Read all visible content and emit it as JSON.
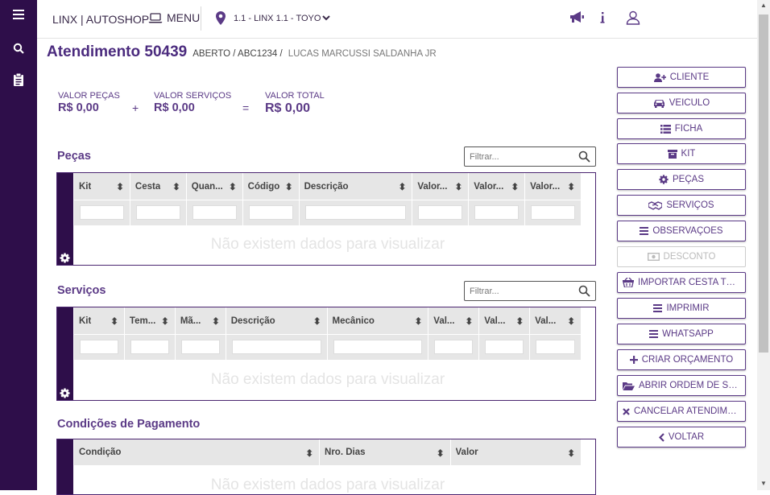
{
  "app": {
    "brand": "LINX | AUTOSHOP",
    "menu_label": "MENU",
    "store": "1.1 - LINX 1.1 - TOYO"
  },
  "header": {
    "title": "Atendimento 50439",
    "status": "ABERTO / ABC1234 /",
    "client": "LUCAS MARCUSSI SALDANHA JR"
  },
  "totals": {
    "pecas_label": "VALOR PEÇAS",
    "pecas_value": "R$ 0,00",
    "servicos_label": "VALOR SERVIÇOS",
    "servicos_value": "R$ 0,00",
    "total_label": "VALOR TOTAL",
    "total_value": "R$ 0,00",
    "plus": "+",
    "equals": "="
  },
  "pecas": {
    "title": "Peças",
    "filter_placeholder": "Filtrar...",
    "columns": [
      "Kit",
      "Cesta",
      "Quan...",
      "Código",
      "Descrição",
      "Valor...",
      "Valor...",
      "Valor..."
    ],
    "empty": "Não existem dados para visualizar"
  },
  "servicos": {
    "title": "Serviços",
    "filter_placeholder": "Filtrar...",
    "columns": [
      "Kit",
      "Tem...",
      "Mã...",
      "Descrição",
      "Mecânico",
      "Val...",
      "Val...",
      "Val..."
    ],
    "empty": "Não existem dados para visualizar"
  },
  "pagamento": {
    "title": "Condições de Pagamento",
    "columns": [
      "Condição",
      "Nro. Dias",
      "Valor"
    ],
    "empty": "Não existem dados para visualizar"
  },
  "actions": [
    {
      "label": "CLIENTE",
      "icon": "user-plus-icon",
      "enabled": true
    },
    {
      "label": "VEÍCULO",
      "icon": "car-icon",
      "enabled": true
    },
    {
      "label": "FICHA",
      "icon": "list-icon",
      "enabled": true
    },
    {
      "label": "KIT",
      "icon": "archive-icon",
      "enabled": true
    },
    {
      "label": "PEÇAS",
      "icon": "cog-icon",
      "enabled": true
    },
    {
      "label": "SERVIÇOS",
      "icon": "handshake-icon",
      "enabled": true
    },
    {
      "label": "OBSERVAÇÕES",
      "icon": "bars-icon",
      "enabled": true
    },
    {
      "label": "DESCONTO",
      "icon": "money-icon",
      "enabled": false
    },
    {
      "label": "IMPORTAR CESTA TOP...",
      "icon": "basket-icon",
      "enabled": true
    },
    {
      "label": "IMPRIMIR",
      "icon": "bars-icon",
      "enabled": true
    },
    {
      "label": "WHATSAPP",
      "icon": "bars-icon",
      "enabled": true
    },
    {
      "label": "CRIAR ORÇAMENTO",
      "icon": "plus-icon",
      "enabled": true
    },
    {
      "label": "ABRIR ORDEM DE SER...",
      "icon": "folder-open-icon",
      "enabled": true
    },
    {
      "label": "CANCELAR ATENDIME...",
      "icon": "times-icon",
      "enabled": true
    },
    {
      "label": "VOLTAR",
      "icon": "chevron-left-icon",
      "enabled": true
    }
  ],
  "colors": {
    "primary": "#5b3a86",
    "rail": "#2e0e4a"
  }
}
